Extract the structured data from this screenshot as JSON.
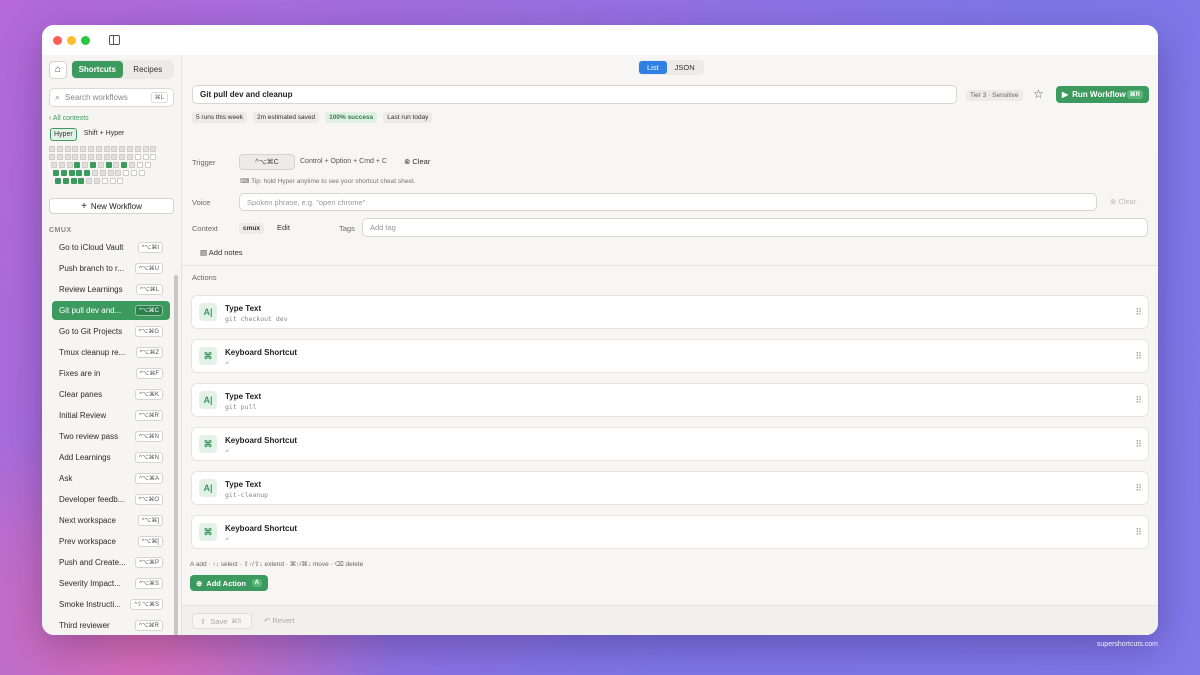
{
  "sidebar": {
    "home_icon": "home-icon",
    "tabs": [
      "Shortcuts",
      "Recipes"
    ],
    "search_placeholder": "Search workflows",
    "search_kbd": "⌘L",
    "all_contexts": "All contexts",
    "modifiers": [
      "Hyper",
      "Shift + Hyper"
    ],
    "new_workflow": "New Workflow",
    "group": "CMUX",
    "items": [
      {
        "label": "Go to iCloud Vault",
        "shortcut": "^⌥⌘I"
      },
      {
        "label": "Push branch to r...",
        "shortcut": "^⌥⌘U"
      },
      {
        "label": "Review Learnings",
        "shortcut": "^⌥⌘L"
      },
      {
        "label": "Git pull dev and...",
        "shortcut": "^⌥⌘C"
      },
      {
        "label": "Go to Git Projects",
        "shortcut": "^⌥⌘G"
      },
      {
        "label": "Tmux cleanup re...",
        "shortcut": "^⌥⌘Z"
      },
      {
        "label": "Fixes are in",
        "shortcut": "^⌥⌘F"
      },
      {
        "label": "Clear panes",
        "shortcut": "^⌥⌘K"
      },
      {
        "label": "Initial Review",
        "shortcut": "^⌥⌘R"
      },
      {
        "label": "Two review pass",
        "shortcut": "^⌥⌘N"
      },
      {
        "label": "Add Learnings",
        "shortcut": "^⌥⌘N"
      },
      {
        "label": "Ask",
        "shortcut": "^⌥⌘A"
      },
      {
        "label": "Developer feedb...",
        "shortcut": "^⌥⌘O"
      },
      {
        "label": "Next workspace",
        "shortcut": "^⌥⌘]"
      },
      {
        "label": "Prev workspace",
        "shortcut": "^⌥⌘["
      },
      {
        "label": "Push and Create...",
        "shortcut": "^⌥⌘P"
      },
      {
        "label": "Severity Impact...",
        "shortcut": "^⌥⌘S"
      },
      {
        "label": "Smoke Instructi...",
        "shortcut": "^⇧⌥⌘S"
      },
      {
        "label": "Third reviewer",
        "shortcut": "^⌥⌘R"
      }
    ],
    "active_index": 3
  },
  "main": {
    "view_tabs": [
      "List",
      "JSON"
    ],
    "title": "Git pull dev and cleanup",
    "tier": "Tier 3 · Sensitive",
    "run_label": "Run Workflow",
    "run_kbd": "⌘R",
    "stats": [
      "5 runs this week",
      "2m estimated saved",
      "100% success",
      "Last run today"
    ],
    "trigger_label": "Trigger",
    "trigger_value": "^⌥⌘C",
    "trigger_text": "Control + Option + Cmd + C",
    "clear_label": "Clear",
    "tip": "Tip: hold Hyper anytime to see your shortcut cheat sheet.",
    "voice_label": "Voice",
    "voice_placeholder": "Spoken phrase, e.g. \"open chrome\"",
    "voice_clear": "Clear",
    "context_label": "Context",
    "context_value": "cmux",
    "edit_label": "Edit",
    "tags_label": "Tags",
    "tags_placeholder": "Add tag",
    "add_notes": "Add notes",
    "actions_label": "Actions",
    "actions": [
      {
        "type": "Type Text",
        "detail": "git checkout dev",
        "icon": "text-cursor-icon"
      },
      {
        "type": "Keyboard Shortcut",
        "detail": "⏎",
        "icon": "command-icon"
      },
      {
        "type": "Type Text",
        "detail": "git pull",
        "icon": "text-cursor-icon"
      },
      {
        "type": "Keyboard Shortcut",
        "detail": "⏎",
        "icon": "command-icon"
      },
      {
        "type": "Type Text",
        "detail": "git-cleanup",
        "icon": "text-cursor-icon"
      },
      {
        "type": "Keyboard Shortcut",
        "detail": "⏎",
        "icon": "command-icon"
      }
    ],
    "hint": "A add  ·  ↑↓ select  ·  ⇧↑/⇧↓ extend  ·  ⌘↑/⌘↓ move  ·  ⌫ delete",
    "add_action": "Add Action",
    "add_action_kbd": "A",
    "save": "Save",
    "save_kbd": "⌘S",
    "revert": "Revert"
  },
  "watermark": "supershortcuts.com",
  "colors": {
    "accent": "#3d9a5e",
    "blue": "#2f7fe4"
  }
}
